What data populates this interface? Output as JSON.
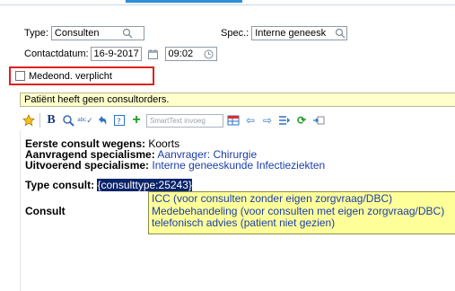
{
  "form": {
    "type_label": "Type:",
    "type_value": "Consulten",
    "spec_label": "Spec.:",
    "spec_value": "Interne geneesk",
    "contact_label": "Contactdatum:",
    "contact_date": "16-9-2017",
    "contact_time": "09:02",
    "medeond_label": "Medeond. verplicht"
  },
  "banner": {
    "text": "Patiënt heeft geen consultorders."
  },
  "toolbar": {
    "smarttext_placeholder": "SmartText invoeg"
  },
  "note": {
    "line1_label": "Eerste consult wegens:",
    "line1_value": " Koorts",
    "line2_label": "Aanvragend specialisme:",
    "line2_value": " Aanvrager: Chirurgie",
    "line3_label": "Uitvoerend specialisme:",
    "line3_value": " Interne geneeskunde Infectieziekten",
    "line4_label": "Type consult:",
    "line4_token": "{consulttype:25243}",
    "line5_label": "Consult"
  },
  "popup": {
    "options": [
      "ICC (voor consulten zonder eigen zorgvraag/DBC)",
      "Medebehandeling (voor consulten met eigen zorgvraag/DBC)",
      "telefonisch advies (patient niet gezien)"
    ]
  },
  "icons": {
    "search": "search-icon",
    "calendar": "calendar-icon",
    "clock": "clock-icon"
  },
  "colors": {
    "highlight_border": "#e02020",
    "banner_bg": "#ffffcc",
    "popup_bg": "#ffff99",
    "token_selection": "#0a246a",
    "value_blue": "#1a3ea8"
  }
}
